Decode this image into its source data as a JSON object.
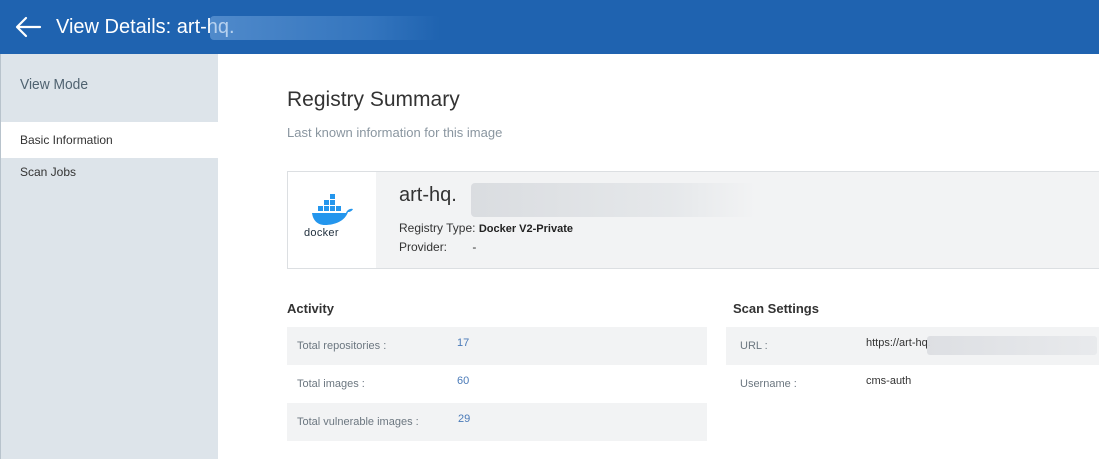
{
  "header": {
    "title": "View Details: art-hq."
  },
  "sidebar": {
    "heading": "View Mode",
    "items": [
      {
        "label": "Basic Information",
        "active": true
      },
      {
        "label": "Scan Jobs",
        "active": false
      }
    ]
  },
  "summary": {
    "title": "Registry Summary",
    "subtitle": "Last known information for this image"
  },
  "registry": {
    "logo_text": "docker",
    "name": "art-hq.",
    "type_label": "Registry Type:",
    "type_value": "Docker V2-Private",
    "provider_label": "Provider:",
    "provider_value": "-"
  },
  "activity": {
    "heading": "Activity",
    "rows": [
      {
        "label": "Total repositories :",
        "value": "17"
      },
      {
        "label": "Total images :",
        "value": "60"
      },
      {
        "label": "Total vulnerable images :",
        "value": "29"
      }
    ]
  },
  "scan_settings": {
    "heading": "Scan Settings",
    "rows": [
      {
        "label": "URL :",
        "value": "https://art-hq."
      },
      {
        "label": "Username :",
        "value": "cms-auth"
      }
    ]
  },
  "colors": {
    "topbar": "#1f63b0",
    "sidebar": "#dde4ea",
    "link_value": "#4a7ab8",
    "docker_blue": "#2496ed"
  }
}
